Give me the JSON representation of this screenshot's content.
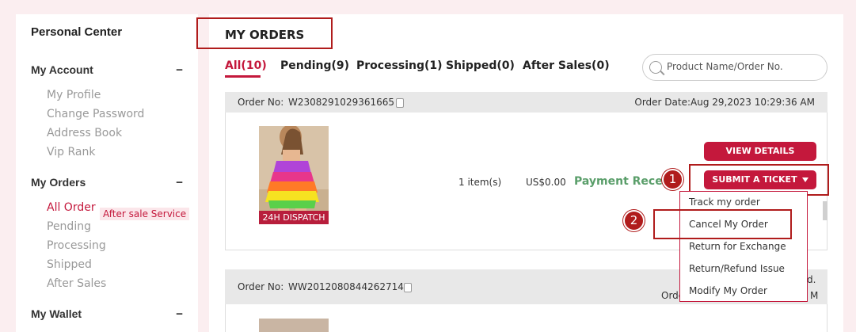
{
  "sidebar": {
    "title": "Personal Center",
    "sections": {
      "account": {
        "label": "My Account",
        "items": [
          "My Profile",
          "Change Password",
          "Address Book",
          "Vip Rank"
        ]
      },
      "orders": {
        "label": "My Orders",
        "items": [
          "All Order",
          "Pending",
          "Processing",
          "Shipped",
          "After Sales"
        ],
        "active": "All Order",
        "tag": "After sale Service"
      },
      "wallet": {
        "label": "My Wallet"
      }
    },
    "collapse_symbol": "−"
  },
  "main": {
    "title": "MY ORDERS",
    "tabs": [
      {
        "label": "All(10)",
        "active": true
      },
      {
        "label": "Pending(9)"
      },
      {
        "label": "Processing(1)"
      },
      {
        "label": "Shipped(0)"
      },
      {
        "label": "After Sales(0)"
      }
    ],
    "search": {
      "placeholder": "Product Name/Order No."
    }
  },
  "orders": [
    {
      "no_label": "Order No:",
      "no": "W2308291029361665",
      "date": "Order Date:Aug 29,2023 10:29:36 AM",
      "dispatch_badge": "24H DISPATCH",
      "qty": "1 item(s)",
      "price": "US$0.00",
      "status": "Payment Received",
      "buttons": {
        "view": "VIEW DETAILS",
        "ticket": "SUBMIT A TICKET"
      }
    },
    {
      "no_label": "Order No:",
      "no": "WW2012080844262714",
      "partial_right_top": "d.",
      "partial_left": "Orde",
      "partial_right": "M"
    }
  ],
  "ticket_menu": [
    "Track my order",
    "Cancel My Order",
    "Return for Exchange",
    "Return/Refund Issue",
    "Modify My Order"
  ],
  "callouts": [
    "1",
    "2"
  ],
  "colors": {
    "accent": "#c4183c",
    "highlight": "#b01c1c",
    "paid": "#5a9e6a"
  }
}
